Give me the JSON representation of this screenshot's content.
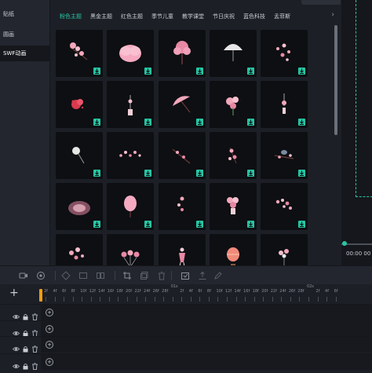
{
  "sidebar": {
    "items": [
      {
        "label": "贴纸"
      },
      {
        "label": "圆画"
      },
      {
        "label": "SWF动画"
      }
    ]
  },
  "tabs": [
    {
      "label": "粉色主题"
    },
    {
      "label": "黑金主题"
    },
    {
      "label": "红色主题"
    },
    {
      "label": "季节儿童"
    },
    {
      "label": "教学课堂"
    },
    {
      "label": "节日庆祝"
    },
    {
      "label": "蓝色科技"
    },
    {
      "label": "孟菲斯"
    }
  ],
  "tab_next_icon": "chevron-right-icon",
  "grid": {
    "tiles": [
      {
        "art": "cherry-branch"
      },
      {
        "art": "pink-cloud"
      },
      {
        "art": "blossom-tree"
      },
      {
        "art": "paper-umbrella"
      },
      {
        "art": "petal-scatter"
      },
      {
        "art": "red-flower"
      },
      {
        "art": "wind-chime"
      },
      {
        "art": "pink-umbrella"
      },
      {
        "art": "flower-bouquet"
      },
      {
        "art": "hanging-charm"
      },
      {
        "art": "round-fan"
      },
      {
        "art": "blossom-scatter"
      },
      {
        "art": "blossom-twig"
      },
      {
        "art": "floral-spray"
      },
      {
        "art": "bird-on-branch"
      },
      {
        "art": "pink-glow"
      },
      {
        "art": "pink-tree"
      },
      {
        "art": "small-blossoms"
      },
      {
        "art": "flower-vase"
      },
      {
        "art": "blossom-cluster"
      },
      {
        "art": "sakura-cluster"
      },
      {
        "art": "pink-balloons"
      },
      {
        "art": "dancer-girl"
      },
      {
        "art": "hot-air-balloon"
      },
      {
        "art": "heart-balloons"
      }
    ],
    "download_icon": "download-icon"
  },
  "preview": {
    "time": "00:00 00"
  },
  "toolbar": {
    "icons": [
      "record-icon",
      "voice-icon",
      "crop-frame-icon",
      "crop-icon",
      "split-icon",
      "trim-icon",
      "copy-icon",
      "delete-icon",
      "snapshot-icon",
      "export-icon",
      "edit-icon"
    ]
  },
  "timeline": {
    "add_track_label": "+",
    "ruler_labels": [
      "2f",
      "4f",
      "6f",
      "8f",
      "10f",
      "12f",
      "14f",
      "16f",
      "18f",
      "20f",
      "22f",
      "24f",
      "26f",
      "28f",
      "01s",
      "2f",
      "4f",
      "6f",
      "8f",
      "10f",
      "12f",
      "14f",
      "16f",
      "18f",
      "20f",
      "22f",
      "24f",
      "26f",
      "28f",
      "02s",
      "2f",
      "4f",
      "6f"
    ],
    "tracks": [
      {
        "add": "+"
      },
      {
        "add": "+"
      },
      {
        "add": "+"
      },
      {
        "add": "+"
      }
    ]
  },
  "colors": {
    "accent": "#26c6a4",
    "playhead": "#f39c12",
    "background": "#1c1f26"
  }
}
